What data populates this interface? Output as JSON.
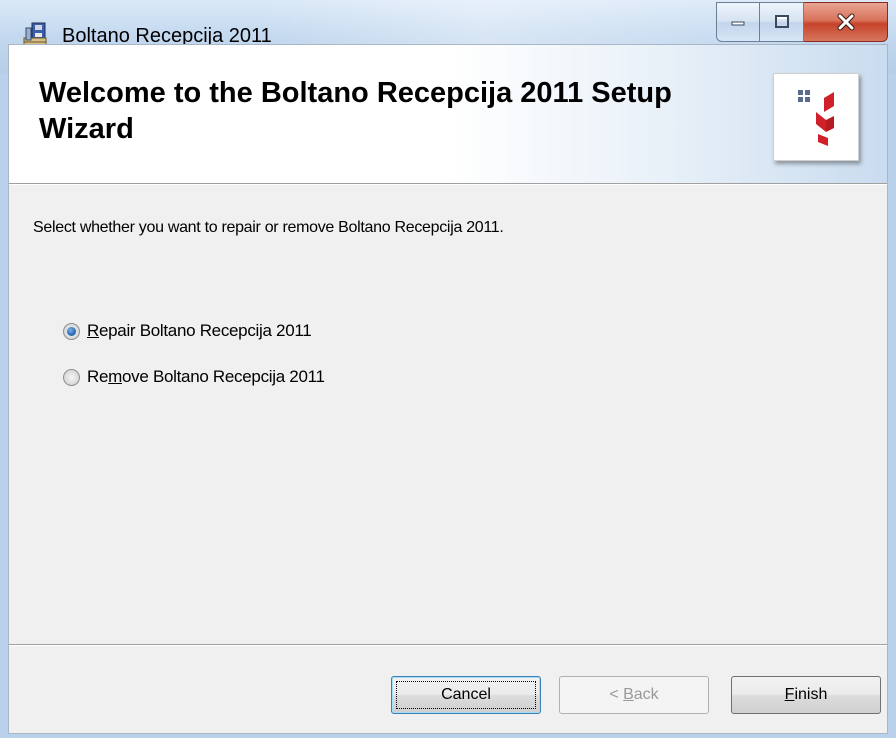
{
  "window": {
    "title": "Boltano  Recepcija 2011"
  },
  "banner": {
    "title": "Welcome to the Boltano  Recepcija 2011 Setup Wizard"
  },
  "main": {
    "instruction": "Select whether you want to repair or remove Boltano  Recepcija 2011.",
    "options": [
      {
        "prefix": "",
        "mnemonic": "R",
        "rest": "epair Boltano  Recepcija 2011",
        "selected": true
      },
      {
        "prefix": "Re",
        "mnemonic": "m",
        "rest": "ove Boltano  Recepcija 2011",
        "selected": false
      }
    ]
  },
  "buttons": {
    "cancel": {
      "label": "Cancel"
    },
    "back": {
      "prefix": "< ",
      "mnemonic": "B",
      "rest": "ack",
      "enabled": false
    },
    "finish": {
      "mnemonic": "F",
      "rest": "inish"
    }
  },
  "colors": {
    "logo_red": "#d0202a",
    "logo_grey": "#5a6b8c",
    "close_red": "#c5432a"
  }
}
